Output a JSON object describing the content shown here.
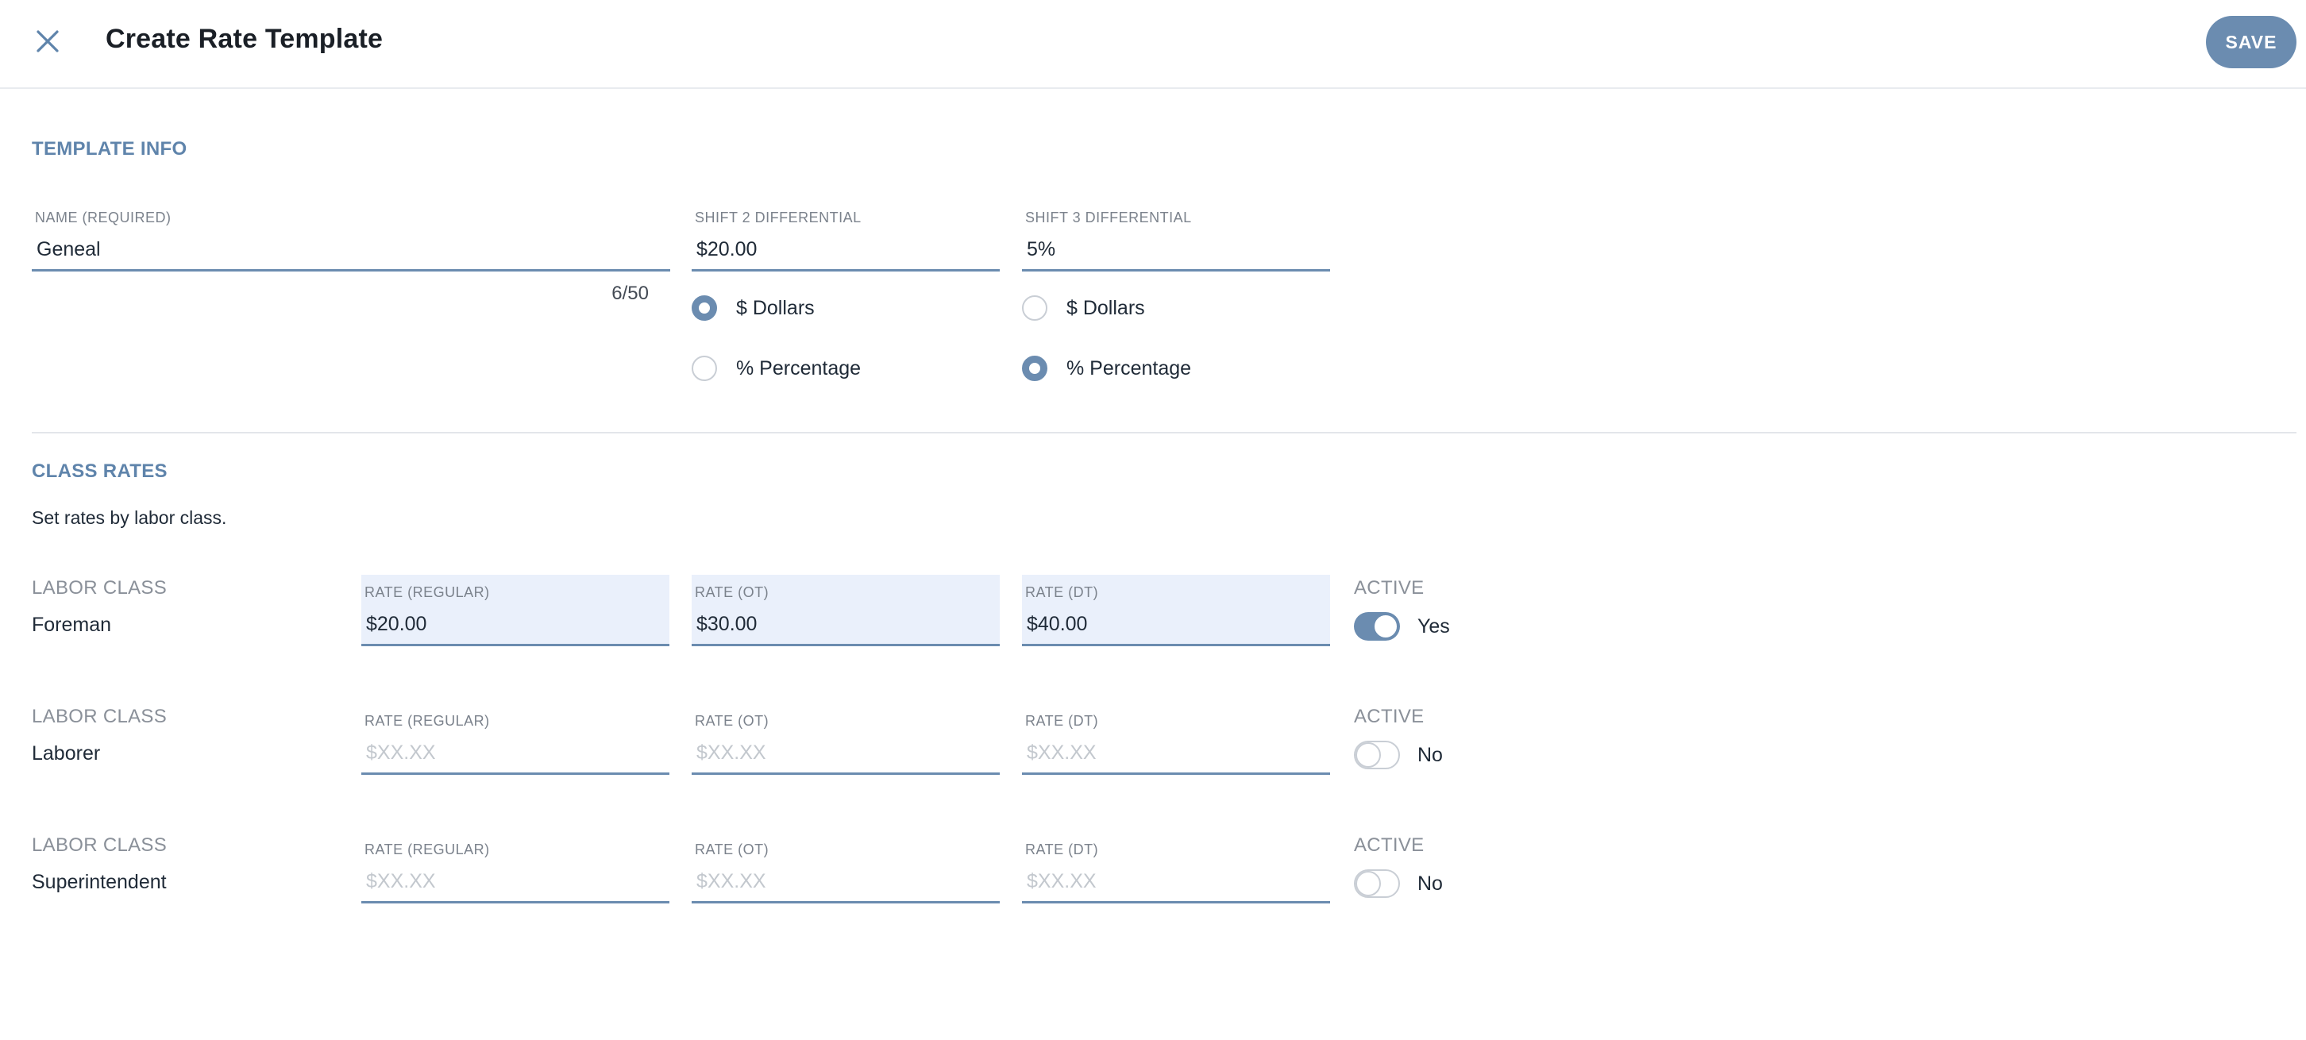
{
  "header": {
    "title": "Create Rate Template",
    "save_label": "SAVE"
  },
  "template_info": {
    "section_title": "TEMPLATE INFO",
    "name": {
      "label": "NAME (REQUIRED)",
      "value": "Geneal",
      "counter": "6/50"
    },
    "shift2": {
      "label": "SHIFT 2 DIFFERENTIAL",
      "value": "$20.00",
      "option_dollars": "$ Dollars",
      "option_percentage": "% Percentage",
      "selected": "dollars"
    },
    "shift3": {
      "label": "SHIFT 3 DIFFERENTIAL",
      "value": "5%",
      "option_dollars": "$ Dollars",
      "option_percentage": "% Percentage",
      "selected": "percentage"
    }
  },
  "class_rates": {
    "section_title": "CLASS RATES",
    "description": "Set rates by labor class.",
    "rows": [
      {
        "labor_class_label": "LABOR CLASS",
        "labor_class": "Foreman",
        "regular_label": "RATE (REGULAR)",
        "regular_value": "$20.00",
        "ot_label": "RATE (OT)",
        "ot_value": "$30.00",
        "dt_label": "RATE (DT)",
        "dt_value": "$40.00",
        "active_label": "ACTIVE",
        "active_text": "Yes",
        "active": true
      },
      {
        "labor_class_label": "LABOR CLASS",
        "labor_class": "Laborer",
        "regular_label": "RATE (REGULAR)",
        "regular_placeholder": "$XX.XX",
        "ot_label": "RATE (OT)",
        "ot_placeholder": "$XX.XX",
        "dt_label": "RATE (DT)",
        "dt_placeholder": "$XX.XX",
        "active_label": "ACTIVE",
        "active_text": "No",
        "active": false
      },
      {
        "labor_class_label": "LABOR CLASS",
        "labor_class": "Superintendent",
        "regular_label": "RATE (REGULAR)",
        "regular_placeholder": "$XX.XX",
        "ot_label": "RATE (OT)",
        "ot_placeholder": "$XX.XX",
        "dt_label": "RATE (DT)",
        "dt_placeholder": "$XX.XX",
        "active_label": "ACTIVE",
        "active_text": "No",
        "active": false
      }
    ]
  },
  "colors": {
    "accent": "#6b8cb0",
    "section_title": "#5f84ab",
    "filled_bg": "#eaf0fb"
  }
}
